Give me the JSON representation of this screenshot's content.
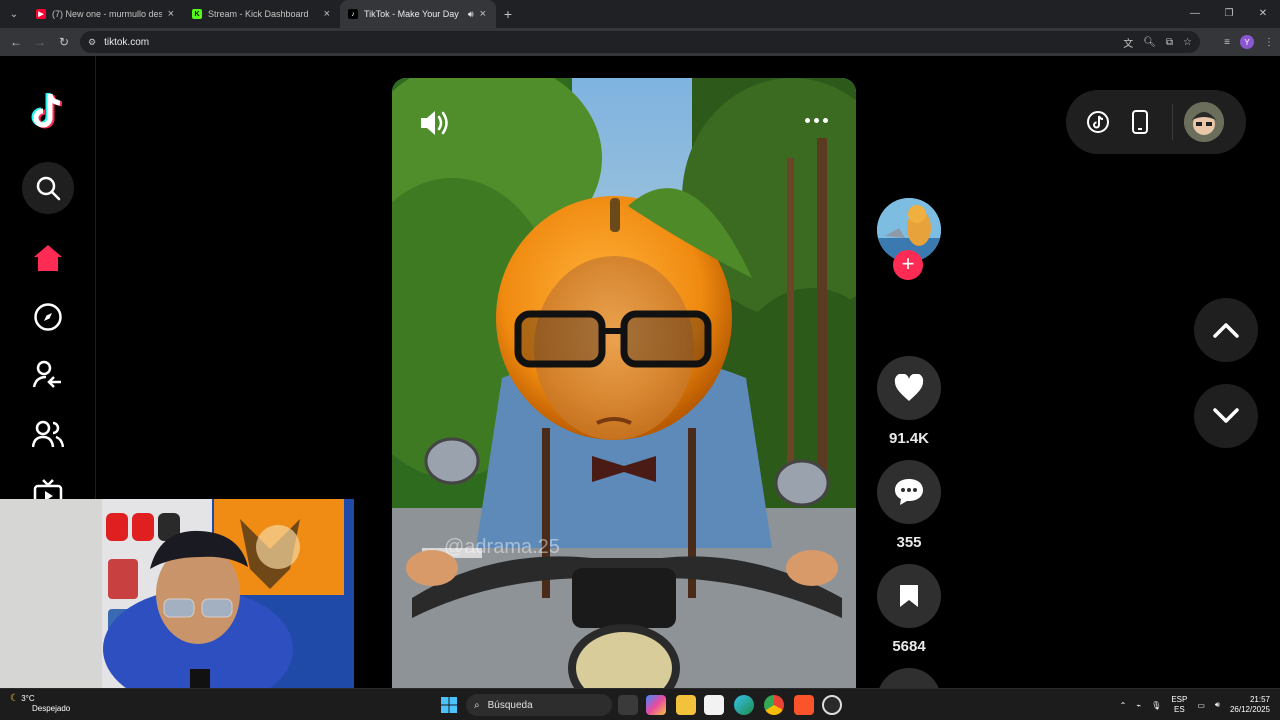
{
  "browser": {
    "tabs": [
      {
        "title": "(7) New one - murmullo descu",
        "favicon": "youtube-icon",
        "color": "#ff0033",
        "active": false
      },
      {
        "title": "Stream - Kick Dashboard",
        "favicon": "kick-icon",
        "color": "#53fc18",
        "active": false
      },
      {
        "title": "TikTok - Make Your Day",
        "favicon": "tiktok-icon",
        "color": "#000000",
        "active": true
      }
    ],
    "url": "tiktok.com"
  },
  "tiktok": {
    "nav": [
      "tiktok-logo",
      "search-icon",
      "home-icon",
      "explore-icon",
      "following-icon",
      "friends-icon",
      "live-icon"
    ],
    "watermark": "@adrama.25",
    "stats": {
      "likes": "91.4K",
      "comments": "355",
      "saves": "5684"
    },
    "colors": {
      "accent": "#fe2c55",
      "home": "#fe2c55"
    }
  },
  "taskbar": {
    "weather_temp": "3°C",
    "weather_desc": "Despejado",
    "search_placeholder": "Búsqueda",
    "lang_top": "ESP",
    "lang_bottom": "ES",
    "time": "21:57",
    "date": "26/12/2025"
  }
}
